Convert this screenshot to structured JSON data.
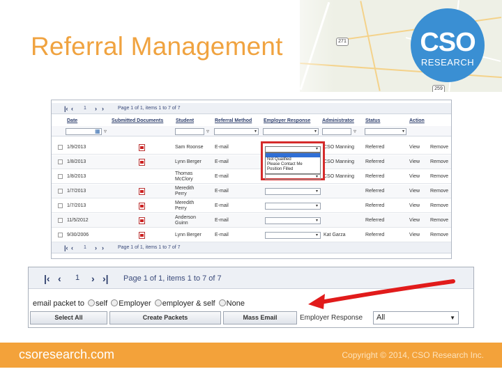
{
  "slide": {
    "title": "Referral Management",
    "logo_main": "CSO",
    "logo_sub": "RESEARCH",
    "accent_color": "#f0a340",
    "footer_color": "#f3a23a",
    "logo_color": "#3a8fd3",
    "map_shields": [
      "271",
      "259"
    ]
  },
  "grid": {
    "pager": {
      "first_icon": "first-page-icon",
      "prev_icon": "prev-page-icon",
      "page": "1",
      "next_icon": "next-page-icon",
      "last_icon": "last-page-icon",
      "text": "Page 1 of 1, items 1 to 7 of 7"
    },
    "columns": [
      "Date",
      "Submitted Documents",
      "Student",
      "Referral Method",
      "Employer Response",
      "Administrator",
      "Status",
      "Action"
    ],
    "rows": [
      {
        "date": "1/9/2013",
        "doc": true,
        "student": "Sam Roonse",
        "method": "E-mail",
        "admin": "CSO Manning",
        "status": "Referred",
        "view": "View",
        "remove": "Remove"
      },
      {
        "date": "1/8/2013",
        "doc": true,
        "student": "Lynn Berger",
        "method": "E-mail",
        "admin": "CSO Manning",
        "status": "Referred",
        "view": "View",
        "remove": "Remove"
      },
      {
        "date": "1/8/2013",
        "doc": false,
        "student": "Thomas McClory",
        "method": "E-mail",
        "admin": "CSO Manning",
        "status": "Referred",
        "view": "View",
        "remove": "Remove"
      },
      {
        "date": "1/7/2013",
        "doc": true,
        "student": "Meredith Perry",
        "method": "E-mail",
        "admin": "",
        "status": "Referred",
        "view": "View",
        "remove": "Remove"
      },
      {
        "date": "1/7/2013",
        "doc": true,
        "student": "Meredith Perry",
        "method": "E-mail",
        "admin": "",
        "status": "Referred",
        "view": "View",
        "remove": "Remove"
      },
      {
        "date": "11/5/2012",
        "doc": true,
        "student": "Anderson Guinn",
        "method": "E-mail",
        "admin": "",
        "status": "Referred",
        "view": "View",
        "remove": "Remove"
      },
      {
        "date": "9/30/2006",
        "doc": true,
        "student": "Lynn Berger",
        "method": "E-mail",
        "admin": "Kat Garza",
        "status": "Referred",
        "view": "View",
        "remove": "Remove"
      }
    ],
    "response_options": [
      "",
      "Not Qualified",
      "Please Contact Me",
      "Position Filled"
    ]
  },
  "toolbar": {
    "page": "1",
    "pager_text": "Page 1 of 1, items 1 to 7 of 7",
    "email_label": "email packet to",
    "radio_options": [
      "self",
      "Employer",
      "employer & self",
      "None"
    ],
    "select_all": "Select All",
    "create_packets": "Create Packets",
    "mass_email": "Mass Email",
    "employer_response_label": "Employer Response",
    "employer_response_value": "All"
  },
  "footer": {
    "site": "csoresearch.com",
    "copyright": "Copyright © 2014, CSO Research Inc."
  }
}
